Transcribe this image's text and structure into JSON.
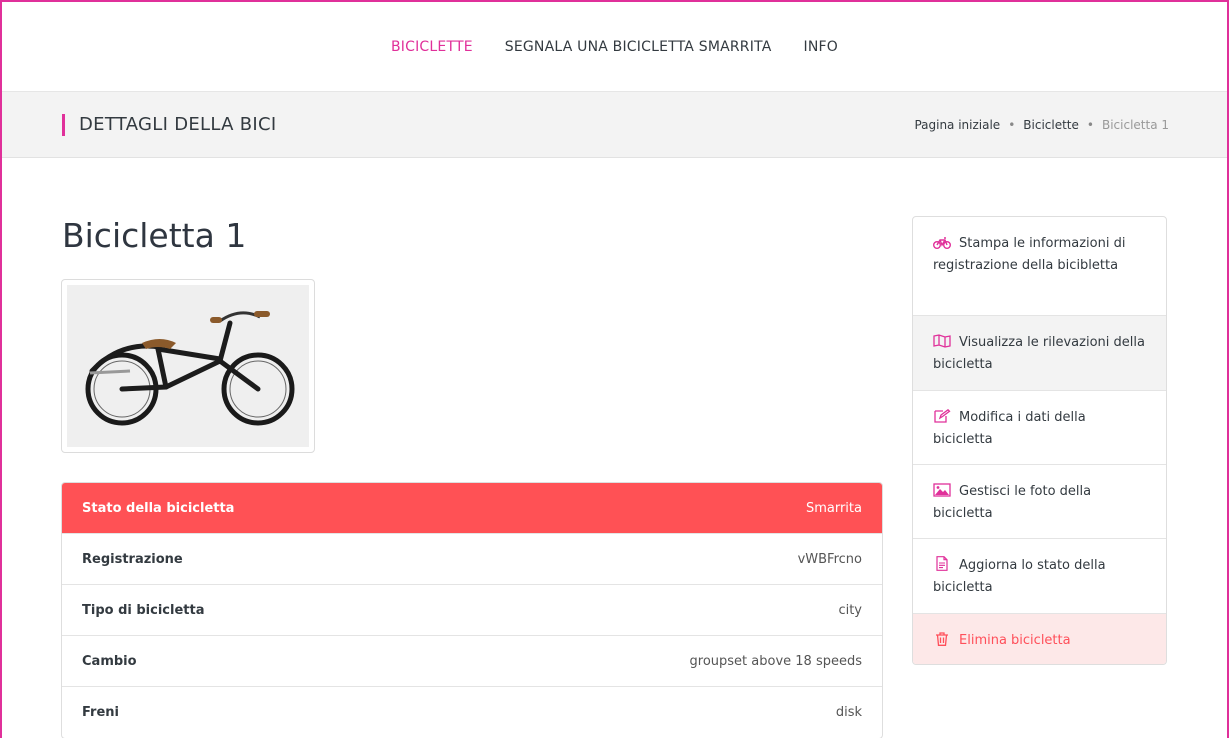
{
  "nav": {
    "items": [
      {
        "label": "BICICLETTE",
        "active": true
      },
      {
        "label": "SEGNALA UNA BICICLETTA SMARRITA",
        "active": false
      },
      {
        "label": "INFO",
        "active": false
      }
    ]
  },
  "header": {
    "title": "DETTAGLI DELLA BICI",
    "breadcrumb": [
      "Pagina iniziale",
      "Biciclette",
      "Bicicletta 1"
    ],
    "separator": "•"
  },
  "bike": {
    "name": "Bicicletta 1",
    "details": [
      {
        "label": "Stato della bicicletta",
        "value": "Smarrita"
      },
      {
        "label": "Registrazione",
        "value": "vWBFrcno"
      },
      {
        "label": "Tipo di bicicletta",
        "value": "city"
      },
      {
        "label": "Cambio",
        "value": "groupset above 18 speeds"
      },
      {
        "label": "Freni",
        "value": "disk"
      }
    ]
  },
  "actions": [
    {
      "icon": "bicycle-icon",
      "label": "Stampa le informazioni di registrazione della bicibletta"
    },
    {
      "icon": "map-icon",
      "label": "Visualizza le rilevazioni della bicicletta"
    },
    {
      "icon": "edit-icon",
      "label": "Modifica i dati della bicicletta"
    },
    {
      "icon": "image-icon",
      "label": "Gestisci le foto della bicicletta"
    },
    {
      "icon": "document-icon",
      "label": "Aggiorna lo stato della bicicletta"
    },
    {
      "icon": "trash-icon",
      "label": "Elimina bicicletta"
    }
  ],
  "colors": {
    "accent": "#e0309a",
    "danger": "#ff5155",
    "danger_light": "#fde8e8"
  }
}
